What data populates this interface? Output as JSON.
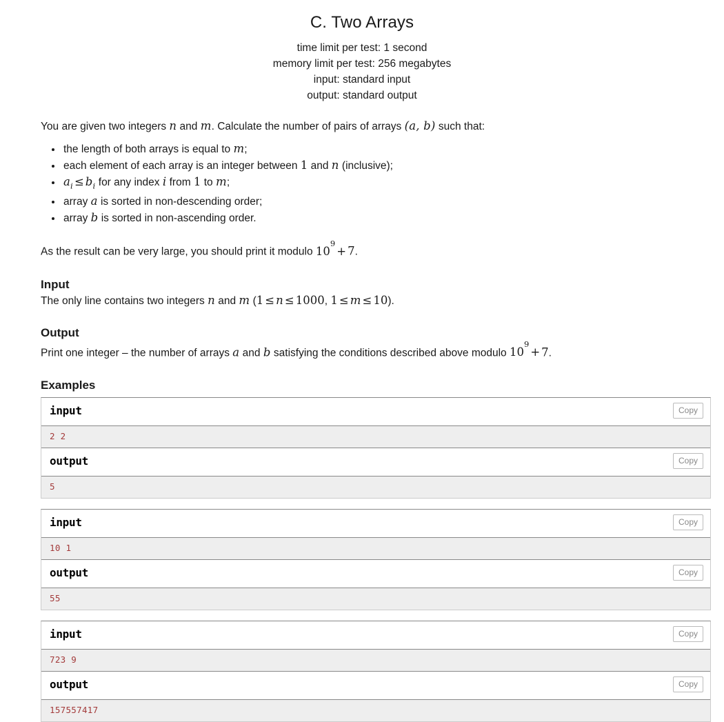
{
  "problem": {
    "title": "C. Two Arrays",
    "limits": [
      "time limit per test: 1 second",
      "memory limit per test: 256 megabytes",
      "input: standard input",
      "output: standard output"
    ],
    "intro": {
      "pre": "You are given two integers ",
      "var_n": "n",
      "mid1": " and ",
      "var_m": "m",
      "mid2": ". Calculate the number of pairs of arrays ",
      "pair": "(a, b)",
      "post": " such that:"
    },
    "conditions": [
      {
        "pre": "the length of both arrays is equal to ",
        "math": "m",
        "post": ";"
      },
      {
        "pre": "each element of each array is an integer between ",
        "math": "1",
        "mid": " and ",
        "math2": "n",
        "post": " (inclusive);"
      },
      {
        "expr_a": "a",
        "sub_a": "i",
        "op": "≤",
        "expr_b": "b",
        "sub_b": "i",
        "mid": " for any index ",
        "var_i": "i",
        "mid2": " from ",
        "num1": "1",
        "mid3": " to ",
        "var_m": "m",
        "post": ";"
      },
      {
        "pre": "array ",
        "math": "a",
        "post": " is sorted in non-descending order;"
      },
      {
        "pre": "array ",
        "math": "b",
        "post": " is sorted in non-ascending order."
      }
    ],
    "modulo_note": {
      "pre": "As the result can be very large, you should print it modulo ",
      "base": "10",
      "exp": "9",
      "plus": "+",
      "addend": "7",
      "post": "."
    },
    "input_section": {
      "title": "Input",
      "pre": "The only line contains two integers ",
      "var_n": "n",
      "mid": " and ",
      "var_m": "m",
      "paren_open": " (",
      "c1_lo": "1",
      "c1_op1": "≤",
      "c1_var": "n",
      "c1_op2": "≤",
      "c1_hi": "1000",
      "comma": ", ",
      "c2_lo": "1",
      "c2_op1": "≤",
      "c2_var": "m",
      "c2_op2": "≤",
      "c2_hi": "10",
      "paren_close": ")."
    },
    "output_section": {
      "title": "Output",
      "pre": "Print one integer – the number of arrays ",
      "var_a": "a",
      "mid": " and ",
      "var_b": "b",
      "post": " satisfying the conditions described above modulo ",
      "base": "10",
      "exp": "9",
      "plus": "+",
      "addend": "7",
      "end": "."
    },
    "examples_title": "Examples",
    "copy_label": "Copy",
    "input_label": "input",
    "output_label": "output",
    "samples": [
      {
        "input": "2 2",
        "output": "5"
      },
      {
        "input": "10 1",
        "output": "55"
      },
      {
        "input": "723 9",
        "output": "157557417"
      }
    ]
  },
  "colors": {
    "sample_text": "#a33a3a",
    "data_background": "#eeeeee",
    "border": "#888888",
    "copy_text": "#888888"
  }
}
